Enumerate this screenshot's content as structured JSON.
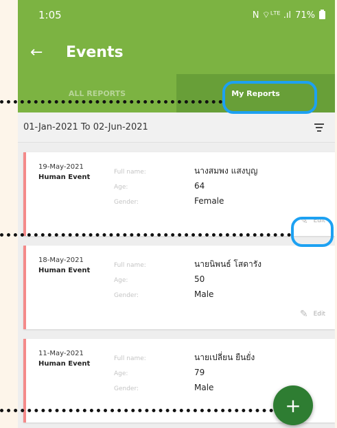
{
  "status_bar": {
    "time": "1:05",
    "indicators": "N ⌔ᴸᵀᴱ .ıl",
    "battery": "71%"
  },
  "app_bar": {
    "back_icon": "←",
    "title": "Events"
  },
  "tabs": [
    {
      "label": "ALL REPORTS",
      "active": false
    },
    {
      "label": "My Reports",
      "active": true
    }
  ],
  "filter": {
    "date_range": "01-Jan-2021 To 02-Jun-2021",
    "icon": "filter-icon"
  },
  "field_labels": {
    "full_name": "Full name:",
    "age": "Age:",
    "gender": "Gender:"
  },
  "cards": [
    {
      "date": "19-May-2021",
      "type": "Human Event",
      "full_name": "นางสมพง แสงบุญ",
      "age": "64",
      "gender": "Female",
      "edit_label": "Edit"
    },
    {
      "date": "18-May-2021",
      "type": "Human Event",
      "full_name": "นายนิพนธ์ โสดารัง",
      "age": "50",
      "gender": "Male",
      "edit_label": "Edit"
    },
    {
      "date": "11-May-2021",
      "type": "Human Event",
      "full_name": "นายเปลี่ยน ยืนยั่ง",
      "age": "79",
      "gender": "Male",
      "edit_label": ""
    }
  ],
  "fab": {
    "icon": "+"
  },
  "annotation": {
    "accent_color": "#1da1f2"
  }
}
